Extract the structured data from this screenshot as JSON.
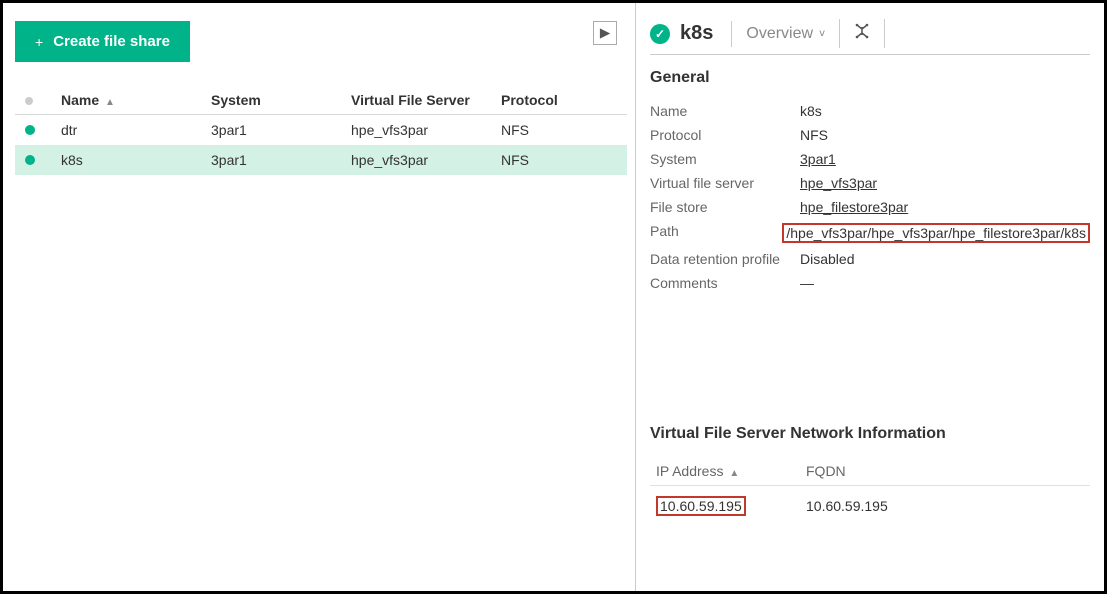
{
  "toolbar": {
    "create_label": "Create file share"
  },
  "table": {
    "headers": {
      "name": "Name",
      "system": "System",
      "vfs": "Virtual File Server",
      "protocol": "Protocol"
    },
    "rows": [
      {
        "name": "dtr",
        "system": "3par1",
        "vfs": "hpe_vfs3par",
        "protocol": "NFS",
        "selected": false
      },
      {
        "name": "k8s",
        "system": "3par1",
        "vfs": "hpe_vfs3par",
        "protocol": "NFS",
        "selected": true
      }
    ]
  },
  "detail": {
    "title": "k8s",
    "tab_label": "Overview",
    "general_title": "General",
    "fields": {
      "name": {
        "label": "Name",
        "value": "k8s"
      },
      "protocol": {
        "label": "Protocol",
        "value": "NFS"
      },
      "system": {
        "label": "System",
        "value": "3par1"
      },
      "vfs": {
        "label": "Virtual file server",
        "value": "hpe_vfs3par"
      },
      "filestore": {
        "label": "File store",
        "value": "hpe_filestore3par"
      },
      "path": {
        "label": "Path",
        "value": "/hpe_vfs3par/hpe_vfs3par/hpe_filestore3par/k8s"
      },
      "retention": {
        "label": "Data retention profile",
        "value": "Disabled"
      },
      "comments": {
        "label": "Comments",
        "value": "—"
      }
    },
    "network_title": "Virtual File Server Network Information",
    "network_headers": {
      "ip": "IP Address",
      "fqdn": "FQDN"
    },
    "network_rows": [
      {
        "ip": "10.60.59.195",
        "fqdn": "10.60.59.195"
      }
    ]
  }
}
